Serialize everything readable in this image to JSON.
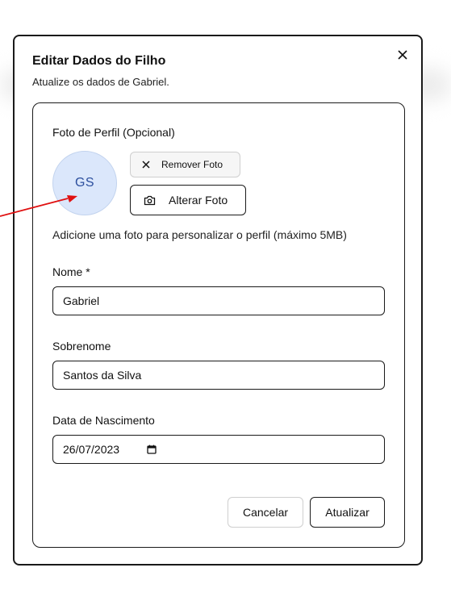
{
  "dialog": {
    "title": "Editar Dados do Filho",
    "subtitle": "Atualize os dados de Gabriel.",
    "close_icon": "close-icon"
  },
  "photo": {
    "label": "Foto de Perfil (Opcional)",
    "initials": "GS",
    "remove_label": "Remover Foto",
    "remove_icon": "x-icon",
    "change_label": "Alterar Foto",
    "change_icon": "camera-icon",
    "hint": "Adicione uma foto para personalizar o perfil (máximo 5MB)"
  },
  "fields": {
    "first_name": {
      "label": "Nome *",
      "value": "Gabriel"
    },
    "last_name": {
      "label": "Sobrenome",
      "value": "Santos da Silva"
    },
    "birth_date": {
      "label": "Data de Nascimento",
      "value": "26/07/2023",
      "icon": "calendar-icon"
    }
  },
  "actions": {
    "cancel_label": "Cancelar",
    "update_label": "Atualizar"
  },
  "colors": {
    "avatar_bg": "#dbe7fb",
    "avatar_text": "#2c4f9e",
    "annotation_arrow": "#e01010"
  }
}
